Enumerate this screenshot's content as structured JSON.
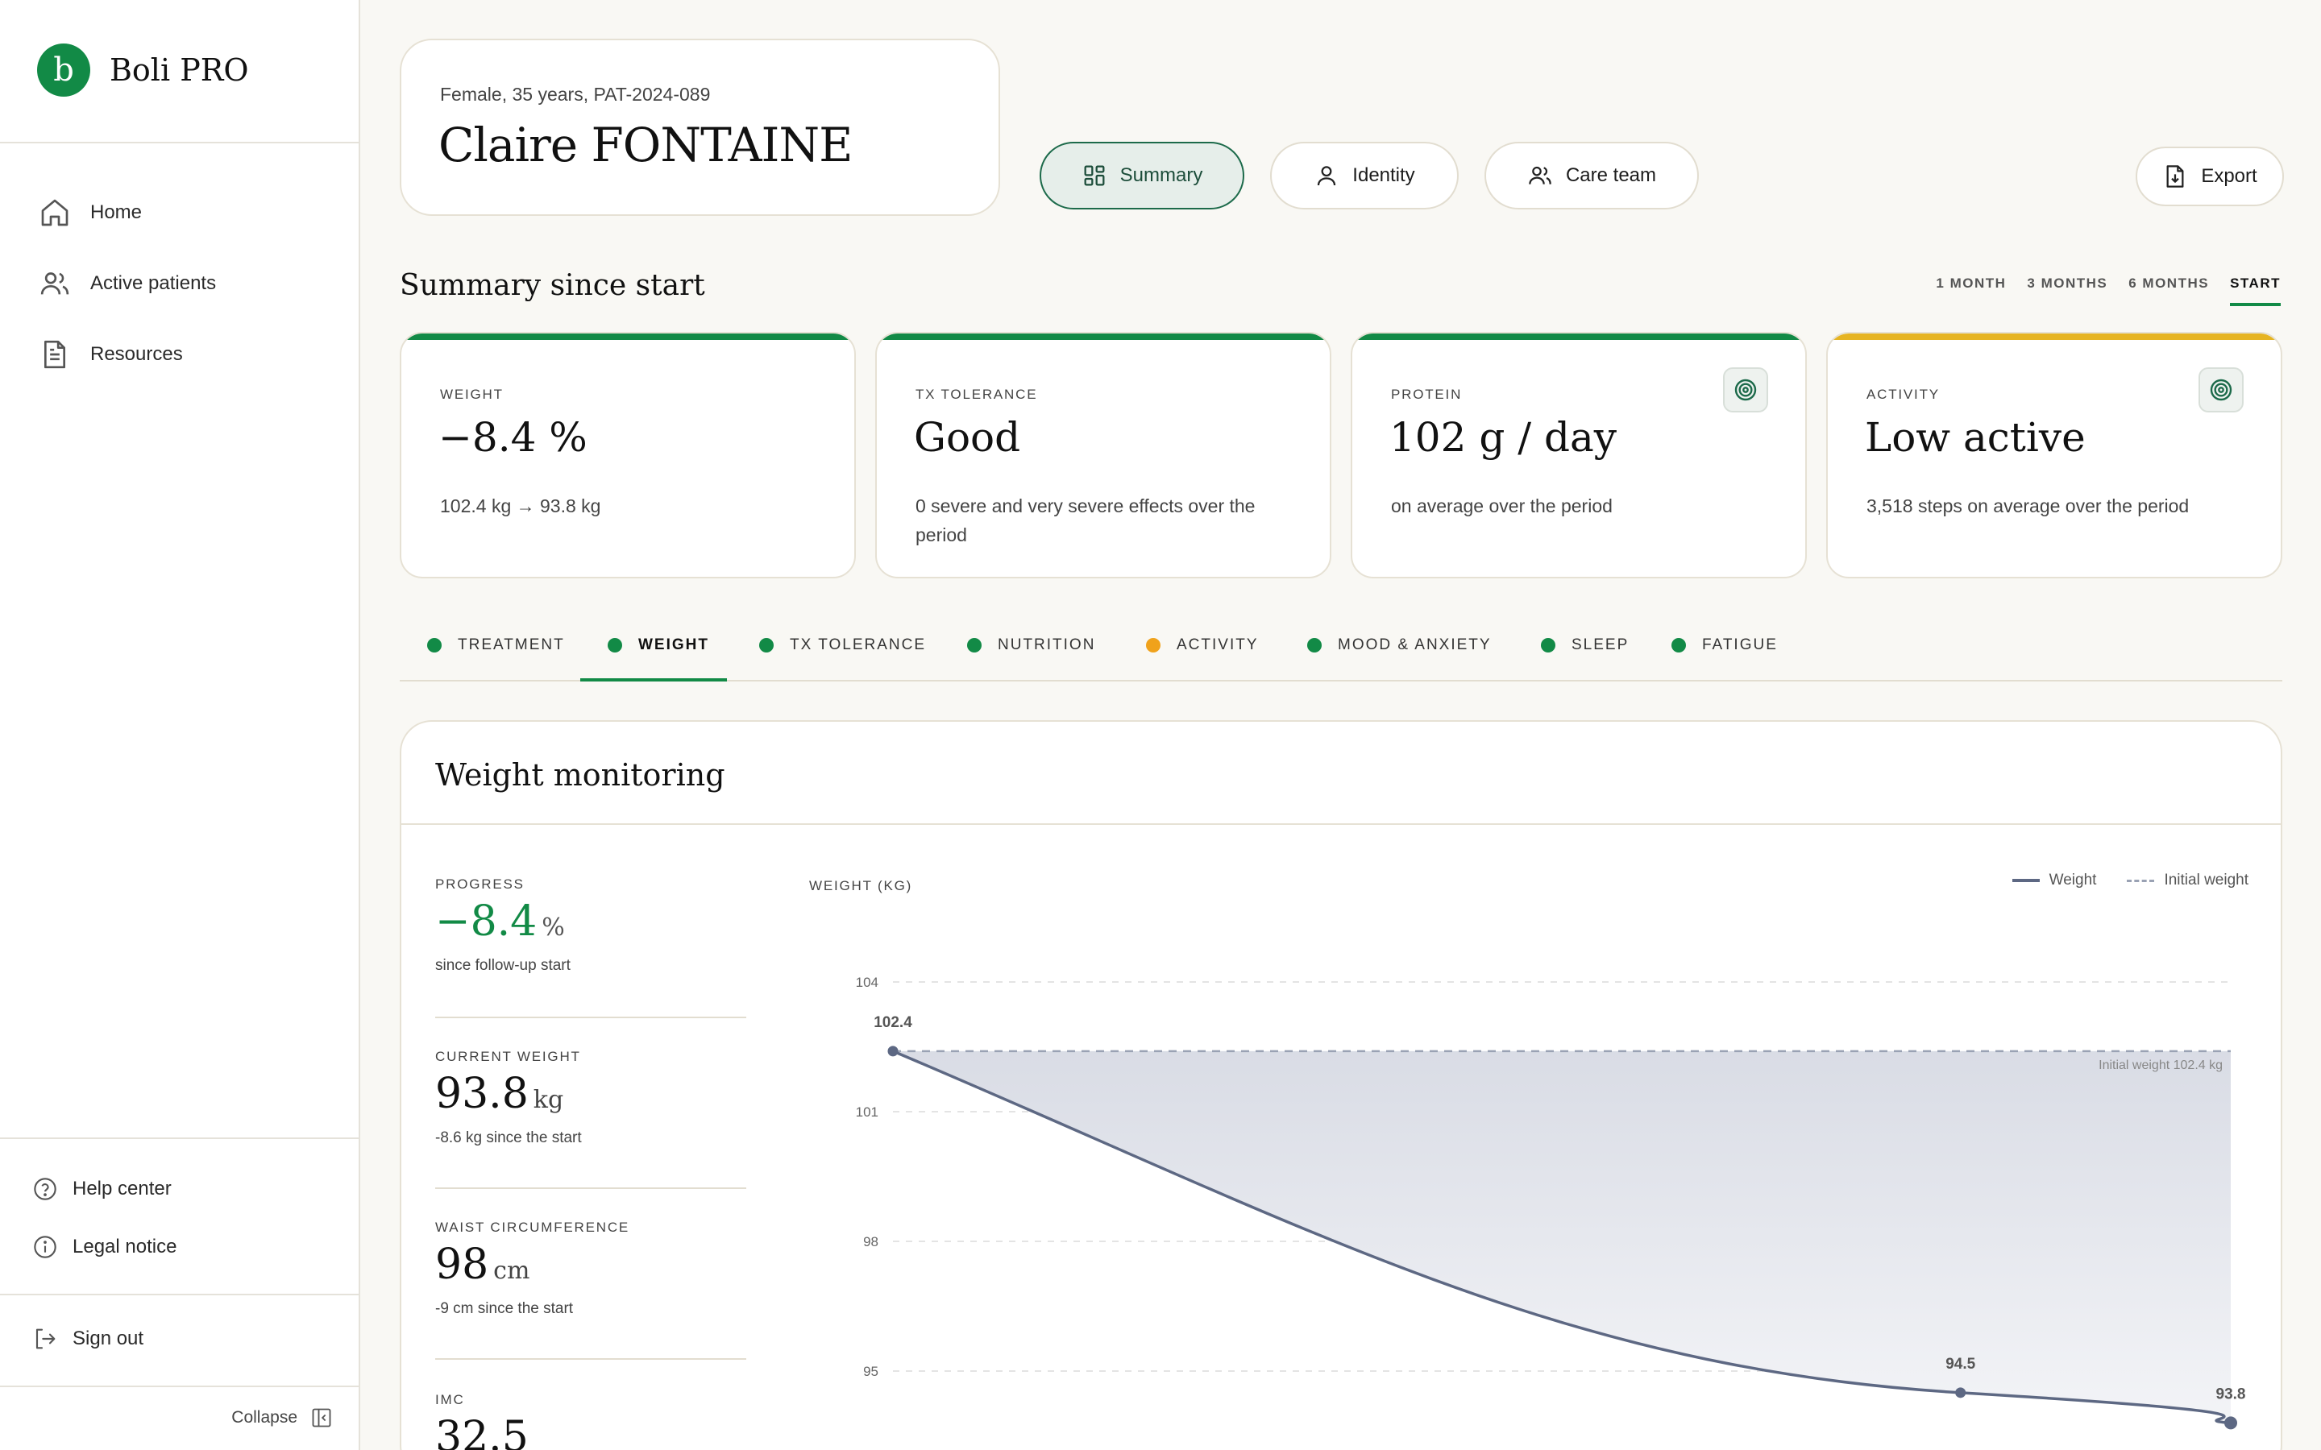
{
  "app": {
    "brand_letter": "b",
    "brand_name": "Boli PRO"
  },
  "sidebar": {
    "nav": [
      {
        "label": "Home",
        "icon": "home-icon"
      },
      {
        "label": "Active patients",
        "icon": "users-icon"
      },
      {
        "label": "Resources",
        "icon": "document-icon"
      }
    ],
    "footer": [
      {
        "label": "Help center",
        "icon": "help-circle-icon"
      },
      {
        "label": "Legal notice",
        "icon": "info-circle-icon"
      }
    ],
    "sign_out": "Sign out",
    "collapse": "Collapse"
  },
  "patient": {
    "meta": "Female, 35 years, PAT-2024-089",
    "name": "Claire FONTAINE"
  },
  "header_tabs": {
    "summary": "Summary",
    "identity": "Identity",
    "care_team": "Care team",
    "export": "Export"
  },
  "summary": {
    "title": "Summary since start",
    "ranges": [
      "1 MONTH",
      "3 MONTHS",
      "6 MONTHS",
      "START"
    ],
    "active_range": "START"
  },
  "stats": [
    {
      "label": "WEIGHT",
      "value": "−8.4 %",
      "note": "102.4 kg → 93.8 kg",
      "bar_color": "#128a46",
      "has_icon": false
    },
    {
      "label": "TX TOLERANCE",
      "value": "Good",
      "note": "0 severe and very severe effects over the period",
      "bar_color": "#128a46",
      "has_icon": false
    },
    {
      "label": "PROTEIN",
      "value": "102 g / day",
      "note": "on average over the period",
      "bar_color": "#128a46",
      "has_icon": true,
      "icon": "target-icon"
    },
    {
      "label": "ACTIVITY",
      "value": "Low active",
      "note": "3,518 steps on average over the period",
      "bar_color": "#e6b422",
      "has_icon": true,
      "icon": "target-icon"
    }
  ],
  "categories": [
    {
      "label": "TREATMENT",
      "color": "#128a46"
    },
    {
      "label": "WEIGHT",
      "color": "#128a46",
      "active": true
    },
    {
      "label": "TX TOLERANCE",
      "color": "#128a46"
    },
    {
      "label": "NUTRITION",
      "color": "#128a46"
    },
    {
      "label": "ACTIVITY",
      "color": "#f0a21b"
    },
    {
      "label": "MOOD & ANXIETY",
      "color": "#128a46"
    },
    {
      "label": "SLEEP",
      "color": "#128a46"
    },
    {
      "label": "FATIGUE",
      "color": "#128a46"
    }
  ],
  "weight_panel": {
    "title": "Weight monitoring",
    "metrics": [
      {
        "label": "PROGRESS",
        "value": "−8.4",
        "unit": "%",
        "note": "since follow-up start",
        "green": true
      },
      {
        "label": "CURRENT WEIGHT",
        "value": "93.8",
        "unit": "kg",
        "note": "-8.6 kg since the start"
      },
      {
        "label": "WAIST CIRCUMFERENCE",
        "value": "98",
        "unit": "cm",
        "note": "-9 cm since the start"
      },
      {
        "label": "IMC",
        "value": "32.5",
        "unit": "",
        "note": ""
      }
    ]
  },
  "chart_data": {
    "type": "line",
    "ylabel": "WEIGHT (KG)",
    "legend": [
      "Weight",
      "Initial weight"
    ],
    "legend_position": "top-right",
    "y_ticks": [
      104,
      101,
      98,
      95
    ],
    "ylim": [
      93.5,
      104
    ],
    "grid": true,
    "series": [
      {
        "name": "Weight",
        "points": [
          {
            "x": 0,
            "y": 102.4,
            "label": "102.4"
          },
          {
            "x": 0.798,
            "y": 94.5,
            "label": "94.5"
          },
          {
            "x": 1,
            "y": 93.8,
            "label": "93.8"
          }
        ]
      }
    ],
    "reference_line": {
      "name": "Initial weight",
      "y": 102.4,
      "label": "Initial weight 102.4 kg"
    },
    "colors": {
      "line": "#5d6883",
      "reference": "#9aa2b4",
      "fill": "#dfe2e9"
    }
  }
}
